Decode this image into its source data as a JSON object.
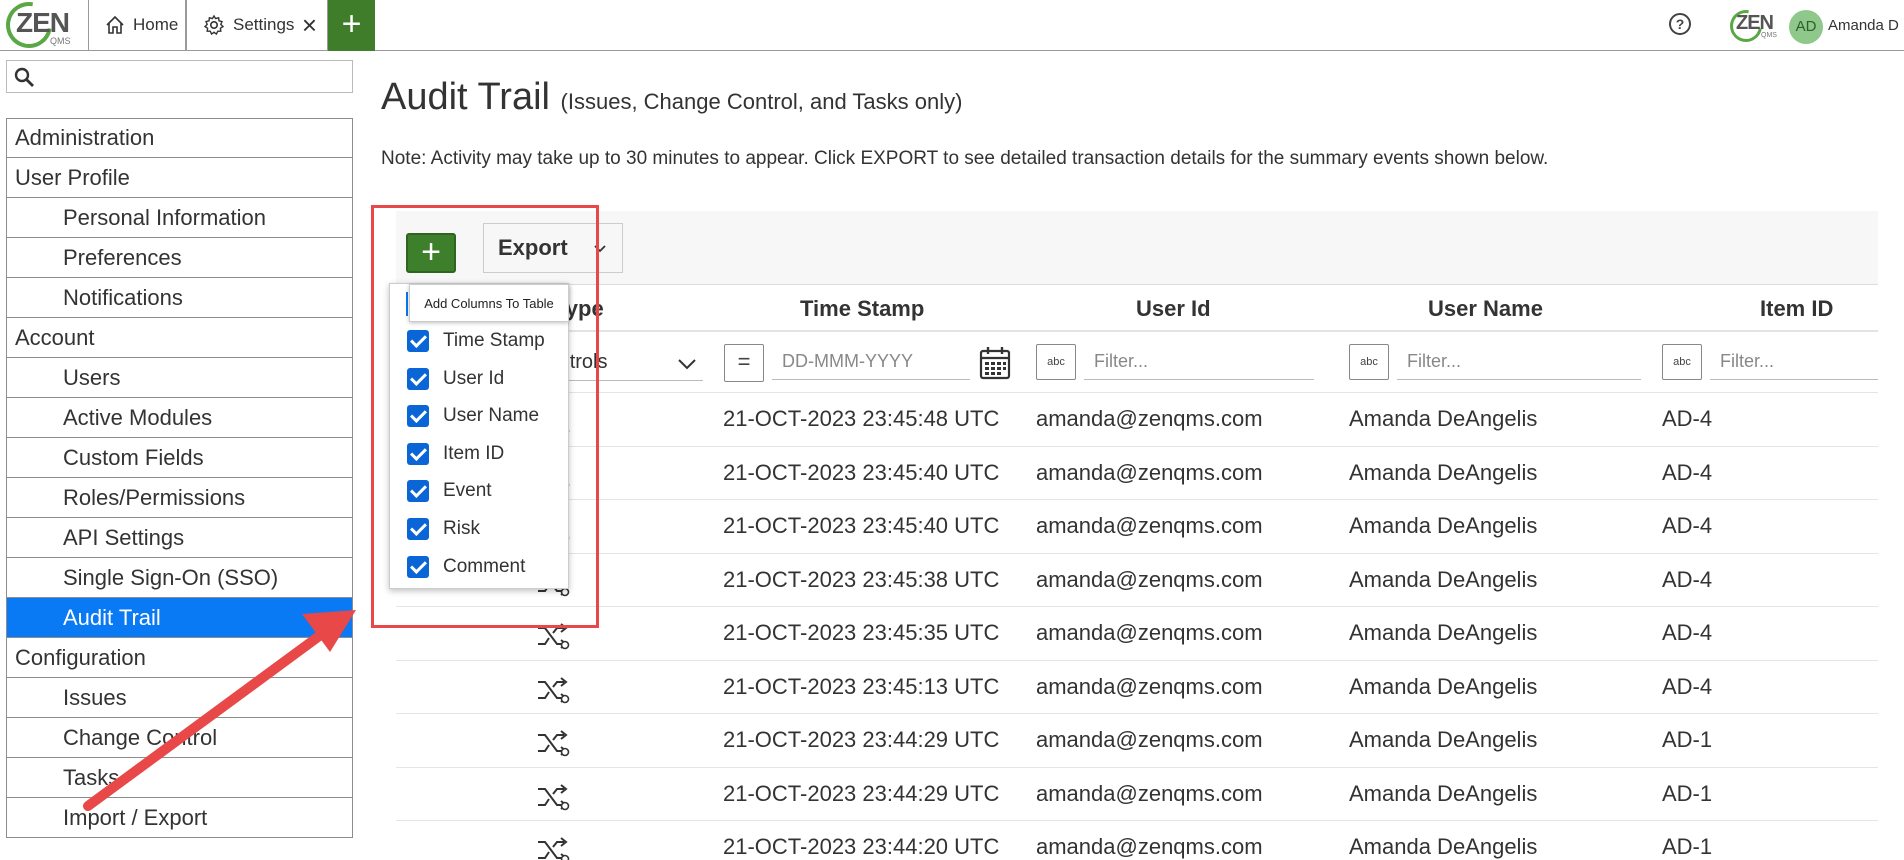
{
  "app": {
    "logo_text": "ZEN",
    "logo_sub": "QMS",
    "tabs": [
      {
        "label": "Home"
      },
      {
        "label": "Settings"
      }
    ],
    "add_tab_label": "+",
    "help_label": "?",
    "user_initials": "AD",
    "user_name": "Amanda D"
  },
  "sidebar": {
    "search_placeholder": "",
    "items": [
      {
        "label": "Administration",
        "level": "group"
      },
      {
        "label": "User Profile",
        "level": "group"
      },
      {
        "label": "Personal Information",
        "level": "sub"
      },
      {
        "label": "Preferences",
        "level": "sub"
      },
      {
        "label": "Notifications",
        "level": "sub"
      },
      {
        "label": "Account",
        "level": "group"
      },
      {
        "label": "Users",
        "level": "sub"
      },
      {
        "label": "Active Modules",
        "level": "sub"
      },
      {
        "label": "Custom Fields",
        "level": "sub"
      },
      {
        "label": "Roles/Permissions",
        "level": "sub"
      },
      {
        "label": "API Settings",
        "level": "sub"
      },
      {
        "label": "Single Sign-On (SSO)",
        "level": "sub"
      },
      {
        "label": "Audit Trail",
        "level": "sub",
        "active": true
      },
      {
        "label": "Configuration",
        "level": "group"
      },
      {
        "label": "Issues",
        "level": "sub"
      },
      {
        "label": "Change Control",
        "level": "sub"
      },
      {
        "label": "Tasks",
        "level": "sub"
      },
      {
        "label": "Import / Export",
        "level": "sub"
      }
    ]
  },
  "main": {
    "title": "Audit Trail",
    "subtitle": "(Issues, Change Control, and Tasks only)",
    "note": "Note: Activity may take up to 30 minutes to appear. Click EXPORT to see detailed transaction details for the summary events shown below.",
    "toolbar": {
      "add_columns_label": "+",
      "export_label": "Export"
    },
    "columns": {
      "type": "Type",
      "time_stamp": "Time Stamp",
      "user_id": "User Id",
      "user_name": "User Name",
      "item_id": "Item ID"
    },
    "filters": {
      "type_value": "Controls",
      "date_placeholder": "DD-MMM-YYYY",
      "text_placeholder": "Filter...",
      "abc_label": "abc",
      "eq_label": "="
    },
    "rows": [
      {
        "time": "21-OCT-2023 23:45:48 UTC",
        "user_id": "amanda@zenqms.com",
        "user_name": "Amanda DeAngelis",
        "item_id": "AD-4"
      },
      {
        "time": "21-OCT-2023 23:45:40 UTC",
        "user_id": "amanda@zenqms.com",
        "user_name": "Amanda DeAngelis",
        "item_id": "AD-4"
      },
      {
        "time": "21-OCT-2023 23:45:40 UTC",
        "user_id": "amanda@zenqms.com",
        "user_name": "Amanda DeAngelis",
        "item_id": "AD-4"
      },
      {
        "time": "21-OCT-2023 23:45:38 UTC",
        "user_id": "amanda@zenqms.com",
        "user_name": "Amanda DeAngelis",
        "item_id": "AD-4"
      },
      {
        "time": "21-OCT-2023 23:45:35 UTC",
        "user_id": "amanda@zenqms.com",
        "user_name": "Amanda DeAngelis",
        "item_id": "AD-4"
      },
      {
        "time": "21-OCT-2023 23:45:13 UTC",
        "user_id": "amanda@zenqms.com",
        "user_name": "Amanda DeAngelis",
        "item_id": "AD-4"
      },
      {
        "time": "21-OCT-2023 23:44:29 UTC",
        "user_id": "amanda@zenqms.com",
        "user_name": "Amanda DeAngelis",
        "item_id": "AD-1"
      },
      {
        "time": "21-OCT-2023 23:44:29 UTC",
        "user_id": "amanda@zenqms.com",
        "user_name": "Amanda DeAngelis",
        "item_id": "AD-1"
      },
      {
        "time": "21-OCT-2023 23:44:20 UTC",
        "user_id": "amanda@zenqms.com",
        "user_name": "Amanda DeAngelis",
        "item_id": "AD-1"
      }
    ]
  },
  "column_menu": {
    "tooltip": "Add Columns To Table",
    "items": [
      {
        "label": "Time Stamp",
        "checked": true
      },
      {
        "label": "User Id",
        "checked": true
      },
      {
        "label": "User Name",
        "checked": true
      },
      {
        "label": "Item ID",
        "checked": true
      },
      {
        "label": "Event",
        "checked": true
      },
      {
        "label": "Risk",
        "checked": true
      },
      {
        "label": "Comment",
        "checked": true
      }
    ]
  },
  "colors": {
    "brand_green": "#3f7d2b",
    "active_blue": "#0a79f4",
    "annotation_red": "#e84848"
  }
}
